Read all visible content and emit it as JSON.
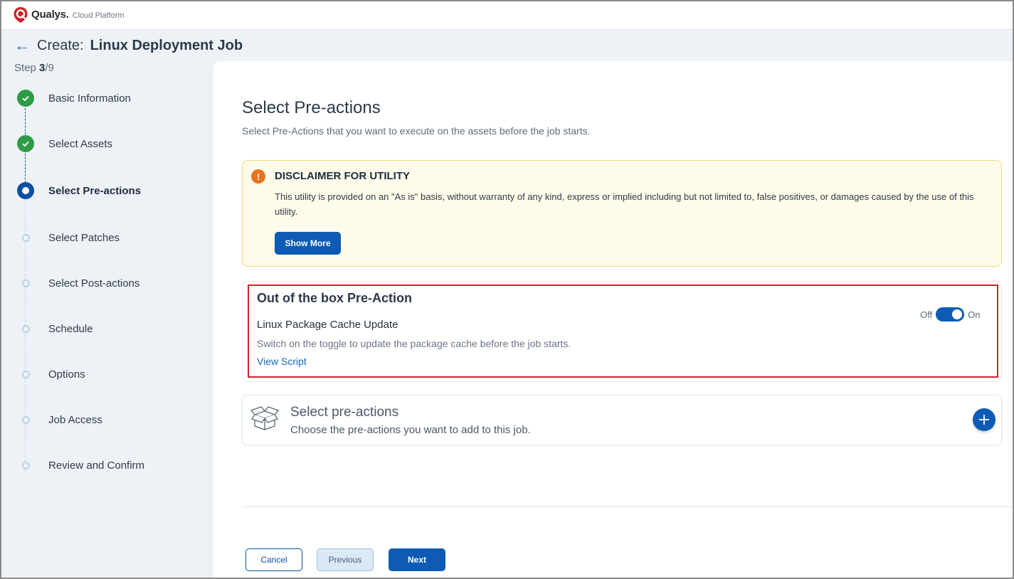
{
  "brand": {
    "name": "Qualys.",
    "product": "Cloud Platform",
    "color": "#d0232b"
  },
  "header": {
    "back_icon": "back-arrow-icon",
    "create_label": "Create:",
    "job_title": "Linux Deployment Job"
  },
  "step_count": {
    "prefix": "Step ",
    "current": "3",
    "total": "/9"
  },
  "steps": [
    {
      "label": "Basic Information",
      "status": "done"
    },
    {
      "label": "Select Assets",
      "status": "done"
    },
    {
      "label": "Select Pre-actions",
      "status": "active"
    },
    {
      "label": "Select Patches",
      "status": "pending"
    },
    {
      "label": "Select Post-actions",
      "status": "pending"
    },
    {
      "label": "Schedule",
      "status": "pending"
    },
    {
      "label": "Options",
      "status": "pending"
    },
    {
      "label": "Job Access",
      "status": "pending"
    },
    {
      "label": "Review and Confirm",
      "status": "pending"
    }
  ],
  "main": {
    "title": "Select Pre-actions",
    "subtitle": "Select Pre-Actions that you want to execute on the assets before the job starts."
  },
  "disclaimer": {
    "title": "DISCLAIMER FOR UTILITY",
    "text": "This utility is provided on an \"As is\" basis, without warranty of any kind, express or implied including but not limited to, false positives, or damages caused by the use of this utility.",
    "button": "Show More"
  },
  "ootb": {
    "title": "Out of the box Pre-Action",
    "name": "Linux Package Cache Update",
    "description": "Switch on the toggle to update the package cache before the job starts.",
    "link": "View Script",
    "toggle_off": "Off",
    "toggle_on": "On",
    "toggle_state": "on"
  },
  "select_card": {
    "icon": "open-box-icon",
    "title": "Select pre-actions",
    "subtitle": "Choose the pre-actions you want to add to this job.",
    "add_icon": "plus-icon"
  },
  "footer": {
    "cancel": "Cancel",
    "previous": "Previous",
    "next": "Next"
  },
  "colors": {
    "primary": "#0d5bb5",
    "success": "#2e9c47",
    "warning": "#e8731f",
    "highlight": "#d0232b"
  }
}
